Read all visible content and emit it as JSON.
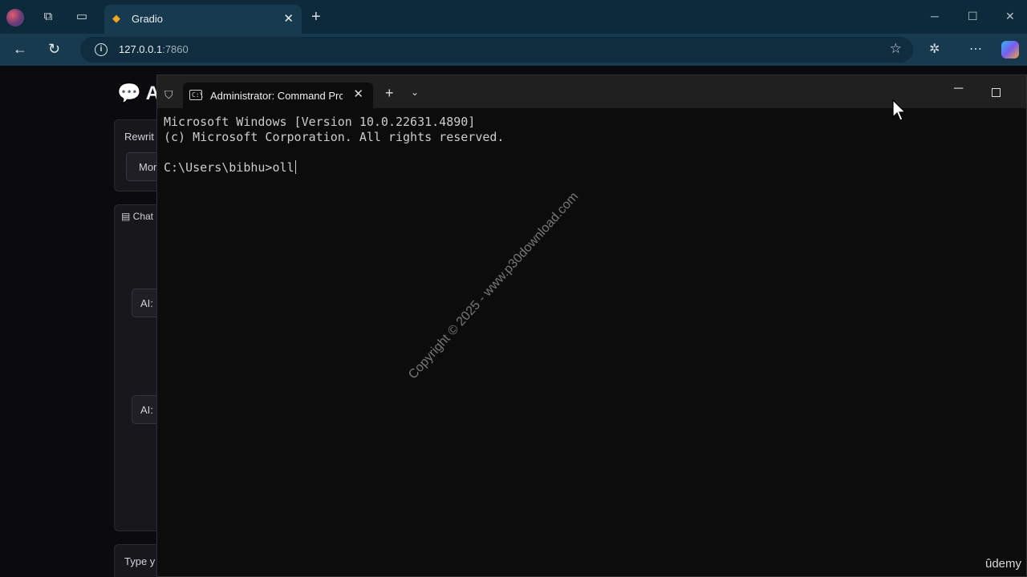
{
  "browser": {
    "tab_title": "Gradio",
    "url_host": "127.0.0.1",
    "url_port": ":7860"
  },
  "gradio": {
    "logo_letter": "A",
    "rewrite_label": "Rewrit",
    "mode_value": "Mor",
    "chat_label": "Chat",
    "ai_label_1": "AI:",
    "ai_label_2": "AI:",
    "input_placeholder": "Type y"
  },
  "terminal": {
    "tab_title": "Administrator: Command Prc",
    "lines": [
      "Microsoft Windows [Version 10.0.22631.4890]",
      "(c) Microsoft Corporation. All rights reserved."
    ],
    "prompt": "C:\\Users\\bibhu>",
    "typed": "oll"
  },
  "watermark": "Copyright © 2025 - www.p30download.com",
  "brand": "ûdemy",
  "icons": {
    "profile": "profile-avatar-icon",
    "workspaces": "workspaces-icon",
    "tab_actions": "tab-actions-icon",
    "favicon": "gradio-favicon-icon",
    "back": "back-arrow-icon",
    "refresh": "refresh-icon",
    "info": "site-info-icon",
    "favorite": "star-icon",
    "extensions": "extensions-icon",
    "more": "more-icon",
    "copilot": "copilot-icon",
    "shield": "shield-icon",
    "cmd": "cmd-icon"
  }
}
